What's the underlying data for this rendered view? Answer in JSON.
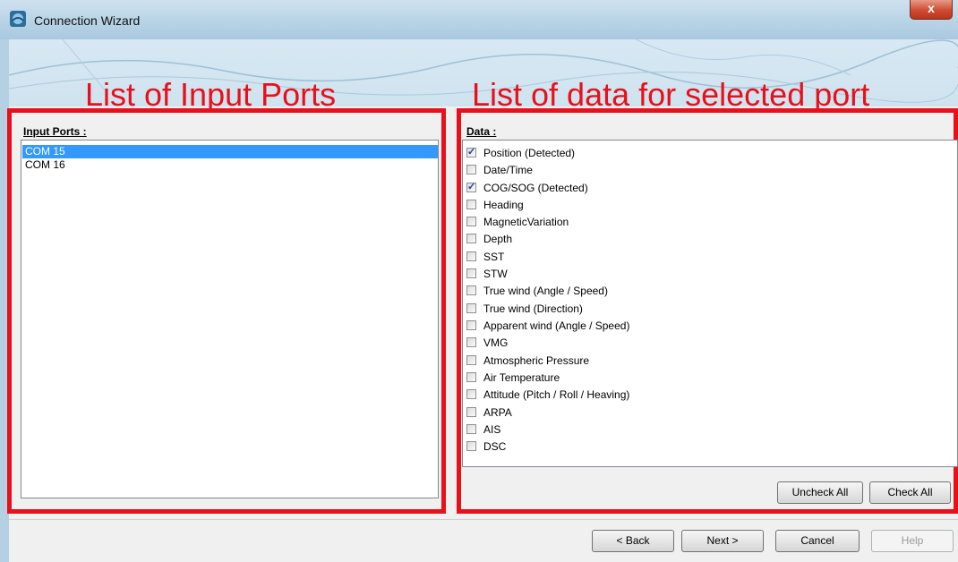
{
  "window": {
    "title": "Connection Wizard",
    "close_glyph": "x",
    "close_color": "#c8412a"
  },
  "annotations": {
    "left": "List of Input Ports",
    "right": "List of data for selected port",
    "color": "#e8101a"
  },
  "ports": {
    "label": "Input Ports :",
    "items": [
      {
        "label": "COM 15",
        "selected": true
      },
      {
        "label": "COM 16",
        "selected": false
      }
    ]
  },
  "data": {
    "label": "Data :",
    "items": [
      {
        "label": "Position (Detected)",
        "checked": true
      },
      {
        "label": "Date/Time",
        "checked": false
      },
      {
        "label": "COG/SOG (Detected)",
        "checked": true
      },
      {
        "label": "Heading",
        "checked": false
      },
      {
        "label": "MagneticVariation",
        "checked": false
      },
      {
        "label": "Depth",
        "checked": false
      },
      {
        "label": "SST",
        "checked": false
      },
      {
        "label": "STW",
        "checked": false
      },
      {
        "label": "True wind (Angle / Speed)",
        "checked": false
      },
      {
        "label": "True wind (Direction)",
        "checked": false
      },
      {
        "label": "Apparent wind (Angle / Speed)",
        "checked": false
      },
      {
        "label": "VMG",
        "checked": false
      },
      {
        "label": "Atmospheric Pressure",
        "checked": false
      },
      {
        "label": "Air Temperature",
        "checked": false
      },
      {
        "label": "Attitude (Pitch / Roll / Heaving)",
        "checked": false
      },
      {
        "label": "ARPA",
        "checked": false
      },
      {
        "label": "AIS",
        "checked": false
      },
      {
        "label": "DSC",
        "checked": false
      }
    ],
    "uncheck_all": "Uncheck All",
    "check_all": "Check All"
  },
  "buttons": {
    "back": "< Back",
    "next": "Next >",
    "cancel": "Cancel",
    "help": "Help"
  },
  "colors": {
    "selection": "#3399ff",
    "window_frame": "#b8d3e6"
  }
}
